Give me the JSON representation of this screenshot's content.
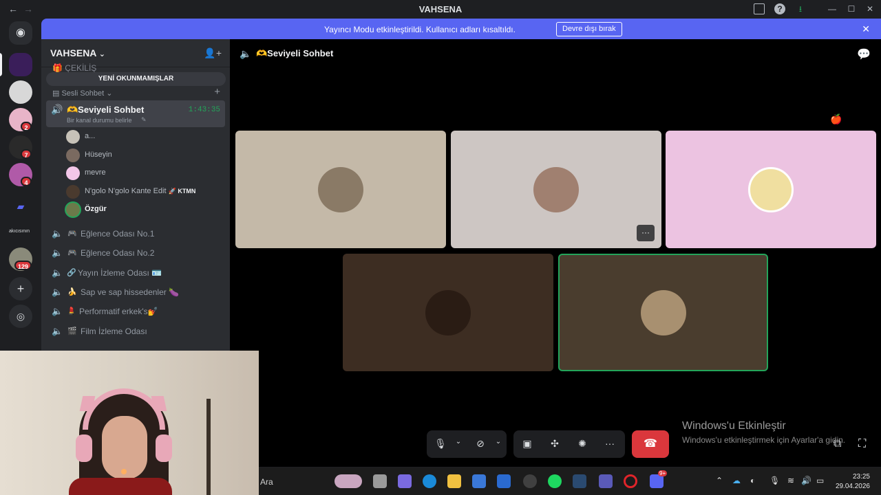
{
  "window": {
    "title": "VAHSENA",
    "back_icon": "←",
    "forward_icon": "→"
  },
  "guilds": {
    "badges": [
      "2",
      "7",
      "4",
      "129"
    ],
    "truncated_label": "akıcısının"
  },
  "banner": {
    "text": "Yayıncı Modu etkinleştirildi. Kullanıcı adları kısaltıldı.",
    "button_label": "Devre dışı bırak",
    "close_icon": "✕"
  },
  "sidebar": {
    "server_name": "VAHSENA",
    "server_chevron": "⌄",
    "cut_channel": "🎁 ÇEKİLİŞ",
    "unread_pill": "YENİ OKUNMAMIŞLAR",
    "category": "Sesli Sohbet",
    "active_channel": {
      "name": "🫶Seviyeli Sohbet",
      "timer": "1:43:35",
      "status": "Bir kanal durumu belirle"
    },
    "voice_users": [
      {
        "name": "a...",
        "color": "#c7c2b8"
      },
      {
        "name": "Hüseyin",
        "color": "#7a6a60"
      },
      {
        "name": "mevre",
        "color": "#f3c6e8"
      },
      {
        "name": "N'golo N'golo Kante Edit",
        "tag": "🚀 KTMN",
        "color": "#4a3a2e"
      },
      {
        "name": "Özgür",
        "color": "#6b7a4a"
      }
    ],
    "channels": [
      {
        "icon": "🎮",
        "name": "Eğlence Odası No.1"
      },
      {
        "icon": "🎮",
        "name": "Eğlence Odası No.2"
      },
      {
        "icon": "🔗",
        "name": "Yayın İzleme Odası 🪪"
      },
      {
        "icon": "🍌",
        "name": "Sap ve sap hissedenler 🍆"
      },
      {
        "icon": "💄",
        "name": "Performatif erkek's💅"
      },
      {
        "icon": "🎬",
        "name": "Film İzleme Odası"
      }
    ]
  },
  "stage": {
    "channel_name": "🫶Seviyeli Sohbet",
    "more_label": "···"
  },
  "watermark": {
    "title": "Windows'u Etkinleştir",
    "subtitle": "Windows'u etkinleştirmek için Ayarlar'a gidin."
  },
  "taskbar": {
    "search_label": "Ara",
    "time": "23:25",
    "date": "29.04.2026",
    "notif_badge": "9+"
  },
  "colors": {
    "accent": "#5865f2",
    "online": "#23a55a",
    "danger": "#da373c"
  }
}
